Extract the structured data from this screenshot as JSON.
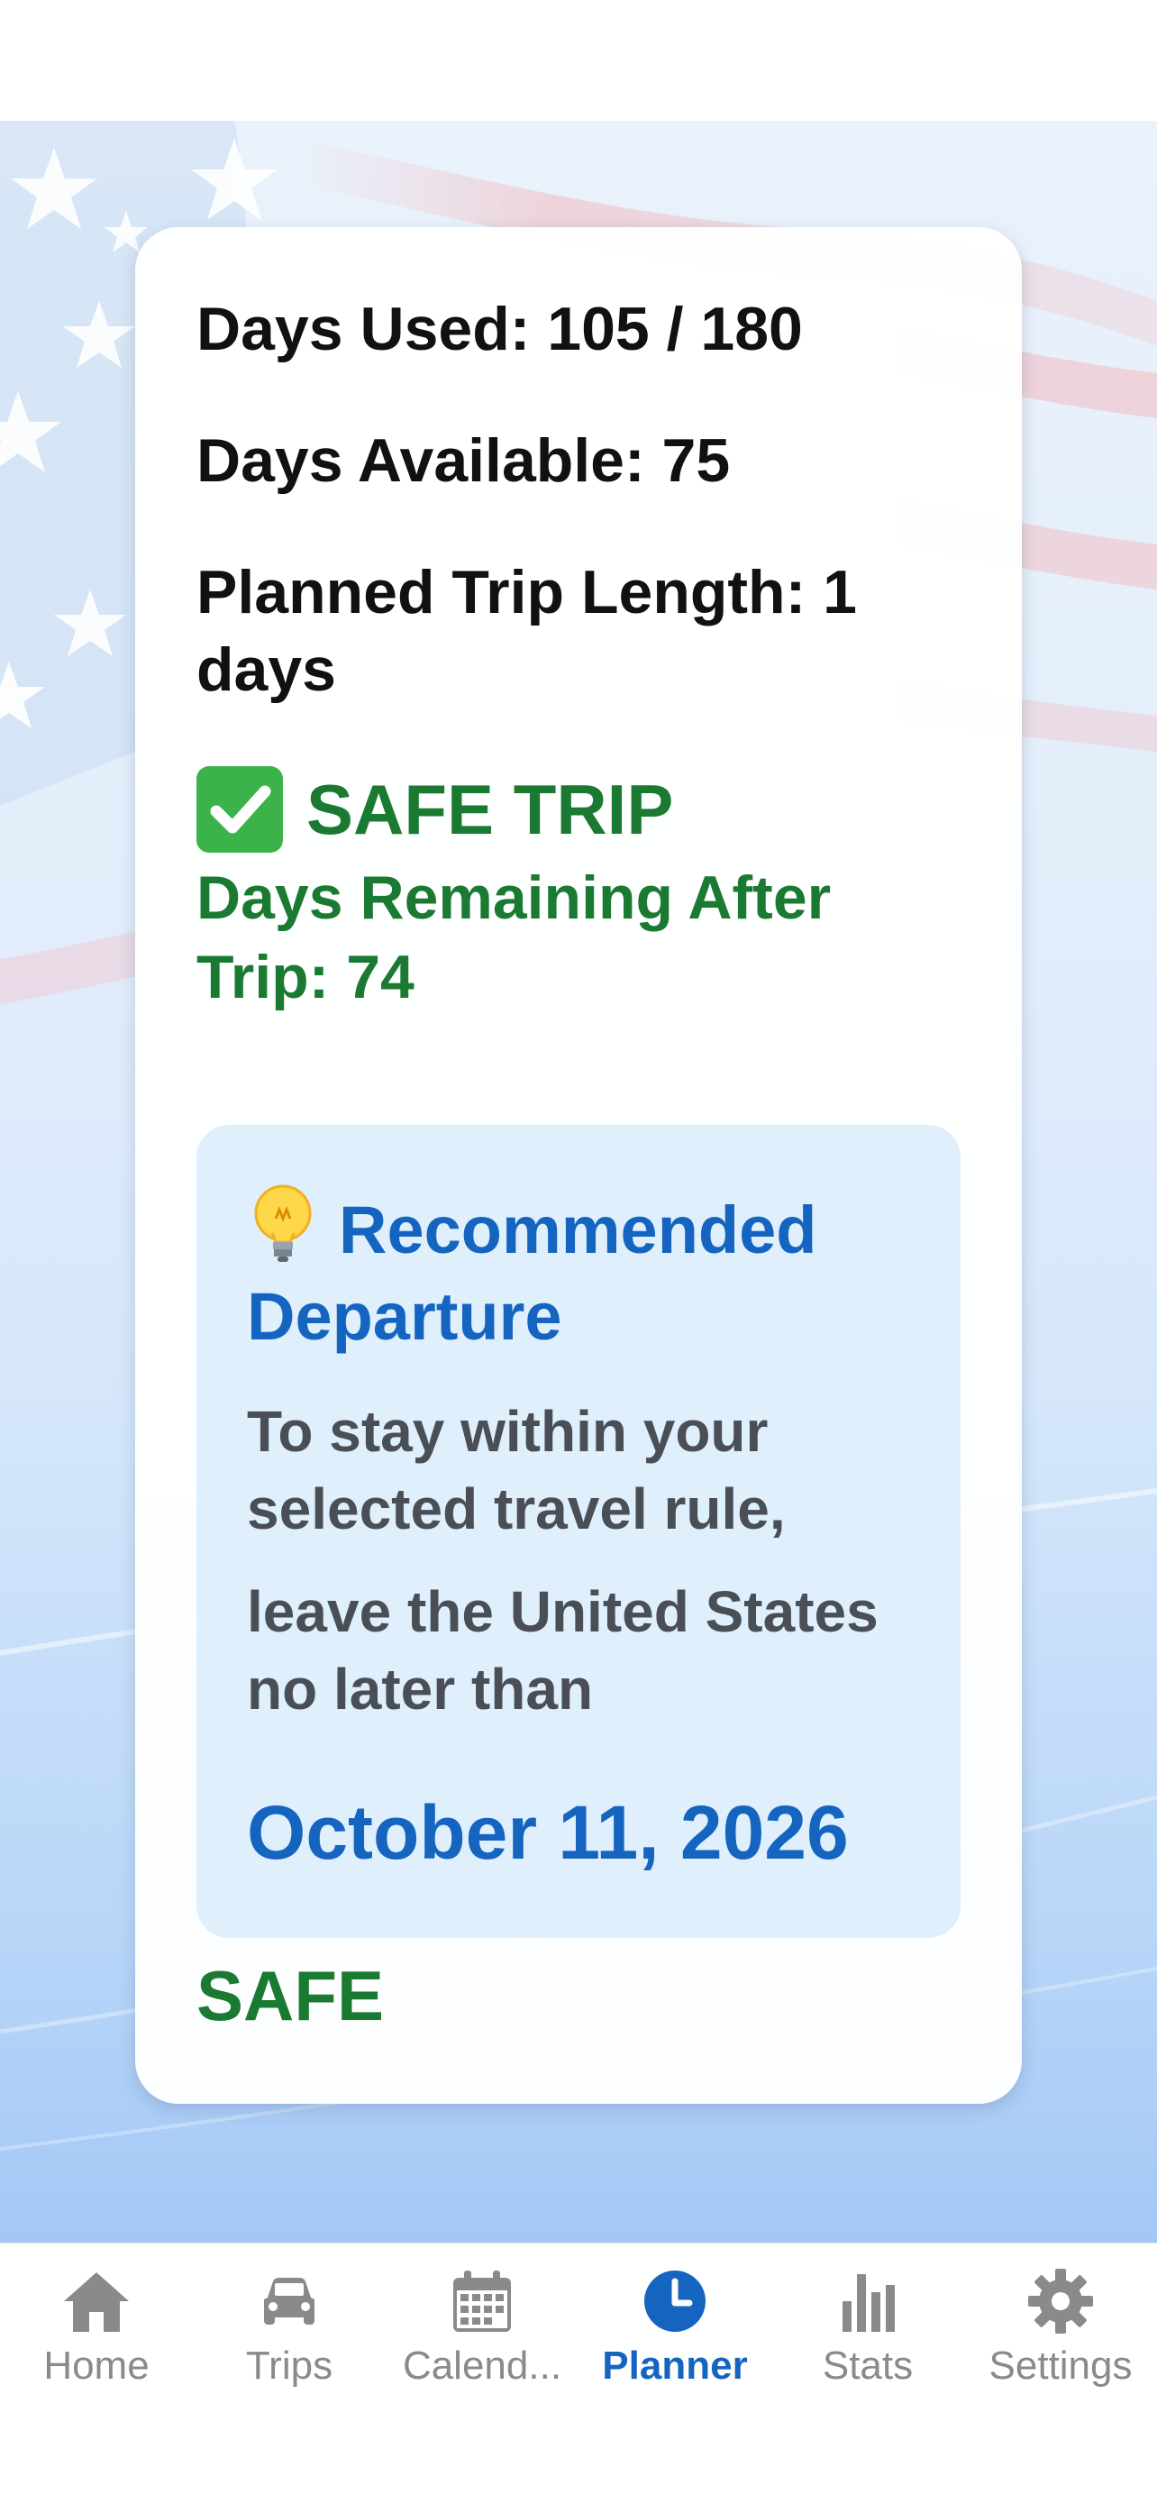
{
  "summary": {
    "days_used": "Days Used: 105 / 180",
    "days_available": "Days Available: 75",
    "planned_trip_length": "Planned Trip Length: 1 days"
  },
  "verdict": {
    "icon": "check-mark-icon",
    "title": "SAFE TRIP",
    "days_remaining": "Days Remaining After Trip: 74"
  },
  "recommendation": {
    "icon": "light-bulb-icon",
    "title": "Recommended Departure",
    "text_line1": "To stay within your selected travel rule,",
    "text_line2": "leave the United States no later than",
    "date": "October 11, 2026"
  },
  "status_label": "SAFE",
  "tabs": [
    {
      "label": "Home",
      "icon": "home-icon",
      "active": false
    },
    {
      "label": "Trips",
      "icon": "car-icon",
      "active": false
    },
    {
      "label": "Calend...",
      "icon": "calendar-icon",
      "active": false
    },
    {
      "label": "Planner",
      "icon": "clock-icon",
      "active": true
    },
    {
      "label": "Stats",
      "icon": "bar-chart-icon",
      "active": false
    },
    {
      "label": "Settings",
      "icon": "gear-icon",
      "active": false
    }
  ],
  "colors": {
    "safe_green": "#1b7a32",
    "accent_blue": "#1565c0",
    "tab_inactive": "#8a8a8a",
    "rec_box_bg": "#dfeffc"
  }
}
